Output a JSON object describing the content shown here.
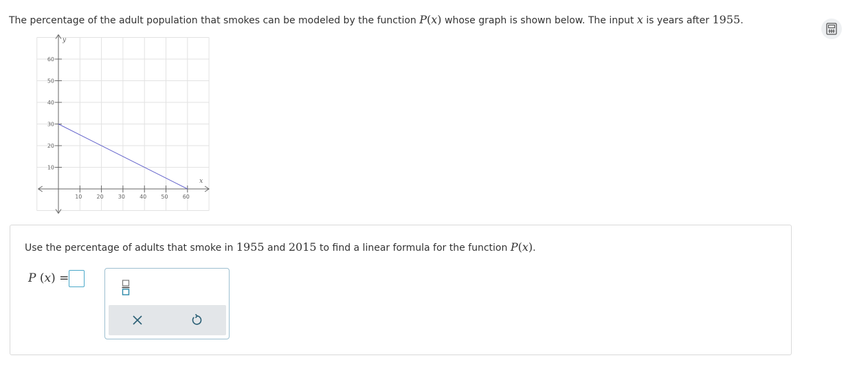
{
  "question": {
    "part1": "The percentage of the adult population that smokes can be modeled by the function ",
    "func": "P",
    "paren_open": "(",
    "var": "x",
    "paren_close": ")",
    "part2": " whose graph is shown below. The input ",
    "var2": "x",
    "part3": " is years after ",
    "year": "1955",
    "end": "."
  },
  "graph": {
    "x_axis_label": "x",
    "y_axis_label": "y",
    "x_ticks": [
      "10",
      "20",
      "30",
      "40",
      "50",
      "60"
    ],
    "y_ticks": [
      "60",
      "50",
      "40",
      "30",
      "20",
      "10"
    ],
    "line": {
      "x": [
        0,
        60
      ],
      "y": [
        30,
        0
      ]
    },
    "xlim": [
      -10,
      70
    ],
    "ylim": [
      -10,
      70
    ],
    "line_color": "#6666cc"
  },
  "instruction": {
    "part1": "Use the percentage of adults that smoke in ",
    "year1": "1955",
    "mid": " and ",
    "year2": "2015",
    "part2": " to find a linear formula for the function ",
    "func": "P",
    "paren_open": "(",
    "var": "x",
    "paren_close": ")",
    "end": "."
  },
  "answer": {
    "func": "P",
    "paren_open": "(",
    "var": "x",
    "paren_close": ")",
    "equals": "=",
    "value": ""
  },
  "palette": {
    "fraction_icon": "fraction-icon",
    "clear_icon": "clear-x-icon",
    "undo_icon": "undo-icon"
  },
  "colors": {
    "input_border": "#4aa8c9",
    "palette_bg": "#e3e6e9",
    "icon_teal": "#2b88a8"
  }
}
